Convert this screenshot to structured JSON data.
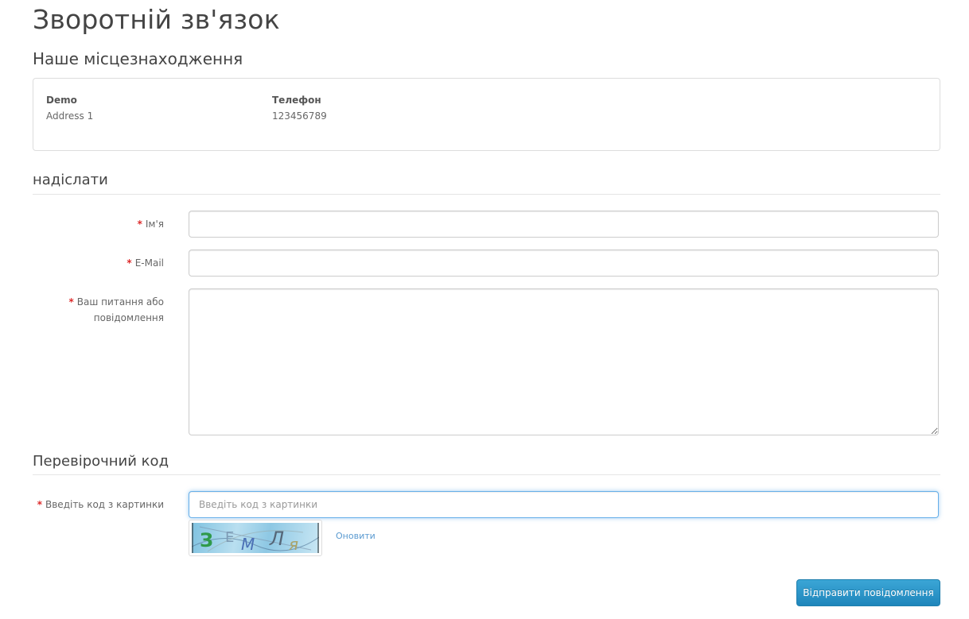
{
  "page": {
    "title": "Зворотній зв'язок"
  },
  "location": {
    "heading": "Наше місцезнаходження",
    "store_name": "Demo",
    "address": "Address 1",
    "phone_label": "Телефон",
    "phone": "123456789"
  },
  "form": {
    "heading": "надіслати",
    "required_mark": "*",
    "name": {
      "label": "Ім'я",
      "value": ""
    },
    "email": {
      "label": "E-Mail",
      "value": ""
    },
    "enquiry": {
      "label": "Ваш питання або повідомлення",
      "value": ""
    }
  },
  "captcha": {
    "heading": "Перевірочний код",
    "label": "Введіть код з картинки",
    "placeholder": "Введіть код з картинки",
    "value": "",
    "image_letters": [
      "З",
      "Е",
      "М",
      "Л",
      "я"
    ],
    "refresh_label": "Оновити"
  },
  "actions": {
    "submit_label": "Відправити повідомлення"
  },
  "colors": {
    "required": "#dd2a2a",
    "accent": "#1f86bb",
    "link": "#5b9bd1",
    "focus_border": "#66afe9"
  }
}
